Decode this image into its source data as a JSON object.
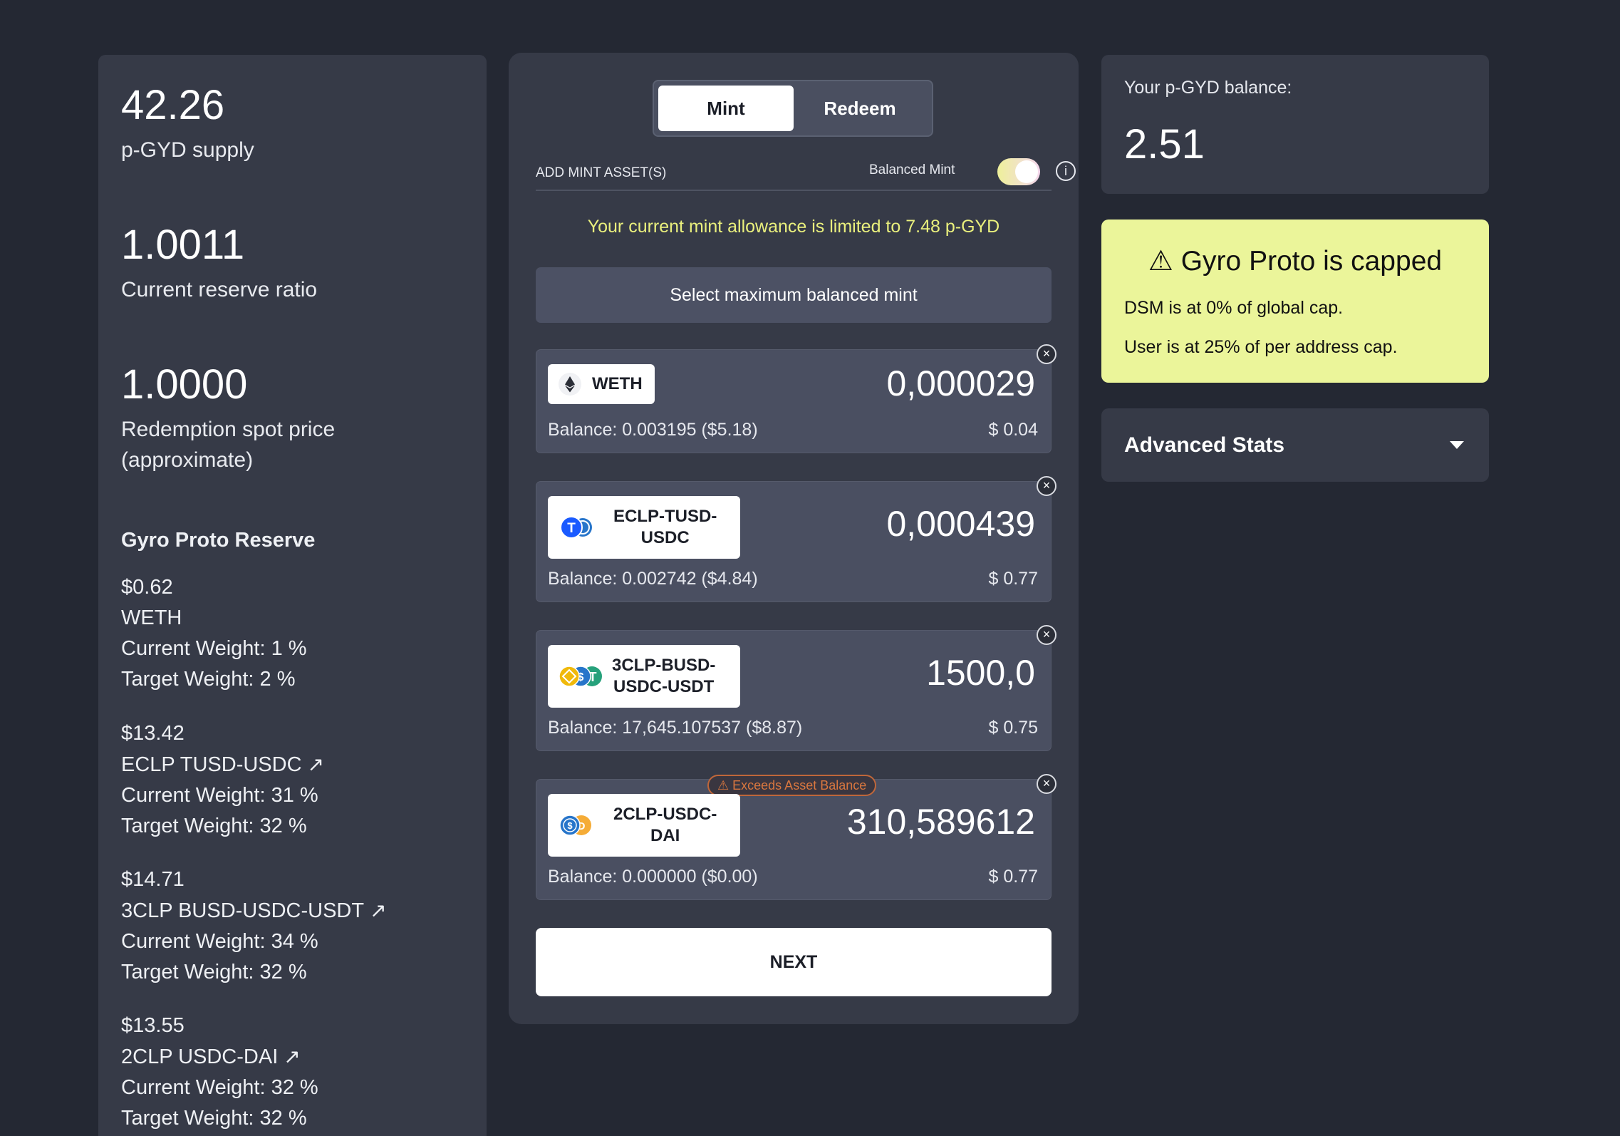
{
  "stats": {
    "supply_value": "42.26",
    "supply_label": "p-GYD supply",
    "ratio_value": "1.0011",
    "ratio_label": "Current reserve ratio",
    "price_value": "1.0000",
    "price_label_1": "Redemption spot price",
    "price_label_2": "(approximate)"
  },
  "reserve": {
    "title": "Gyro Proto Reserve",
    "items": [
      {
        "value": "$0.62",
        "name": "WETH",
        "current": "Current Weight: 1 %",
        "target": "Target Weight: 2 %"
      },
      {
        "value": "$13.42",
        "name": "ECLP TUSD-USDC",
        "current": "Current Weight: 31 %",
        "target": "Target Weight: 32 %"
      },
      {
        "value": "$14.71",
        "name": "3CLP BUSD-USDC-USDT",
        "current": "Current Weight: 34 %",
        "target": "Target Weight: 32 %"
      },
      {
        "value": "$13.55",
        "name": "2CLP USDC-DAI",
        "current": "Current Weight: 32 %",
        "target": "Target Weight: 32 %"
      }
    ],
    "external_glyph": "↗"
  },
  "tabs": {
    "mint": "Mint",
    "redeem": "Redeem"
  },
  "mint": {
    "add_label": "ADD MINT ASSET(S)",
    "balanced_label": "Balanced Mint",
    "balanced_on": true,
    "info_glyph": "i",
    "allowance": "Your current mint allowance is limited to 7.48 p-GYD",
    "max_button": "Select maximum balanced mint",
    "close_glyph": "×",
    "assets": [
      {
        "token": "WETH",
        "amount": "0,000029",
        "balance": "Balance: 0.003195  ($5.18)",
        "usd": "$ 0.04"
      },
      {
        "token_1": "ECLP-TUSD-",
        "token_2": "USDC",
        "amount": "0,000439",
        "balance": "Balance: 0.002742  ($4.84)",
        "usd": "$ 0.77"
      },
      {
        "token_1": "3CLP-BUSD-",
        "token_2": "USDC-USDT",
        "amount": "1500,0",
        "balance": "Balance: 17,645.107537  ($8.87)",
        "usd": "$ 0.75"
      },
      {
        "token_1": "2CLP-USDC-",
        "token_2": "DAI",
        "amount": "310,589612",
        "balance": "Balance: 0.000000  ($0.00)",
        "usd": "$ 0.77",
        "warning": "⚠ Exceeds Asset Balance"
      }
    ],
    "next_button": "NEXT"
  },
  "balance": {
    "label": "Your p-GYD balance:",
    "value": "2.51"
  },
  "cap": {
    "title": "⚠ Gyro Proto is capped",
    "line1": "DSM is at 0% of global cap.",
    "line2": "User is at 25% of per address cap."
  },
  "advanced": {
    "label": "Advanced Stats"
  },
  "colors": {
    "background": "#242833",
    "panel": "#363a47",
    "accent_yellow": "#eaf07d",
    "cap_bg": "#ebf59a",
    "warning": "#d9773f"
  }
}
